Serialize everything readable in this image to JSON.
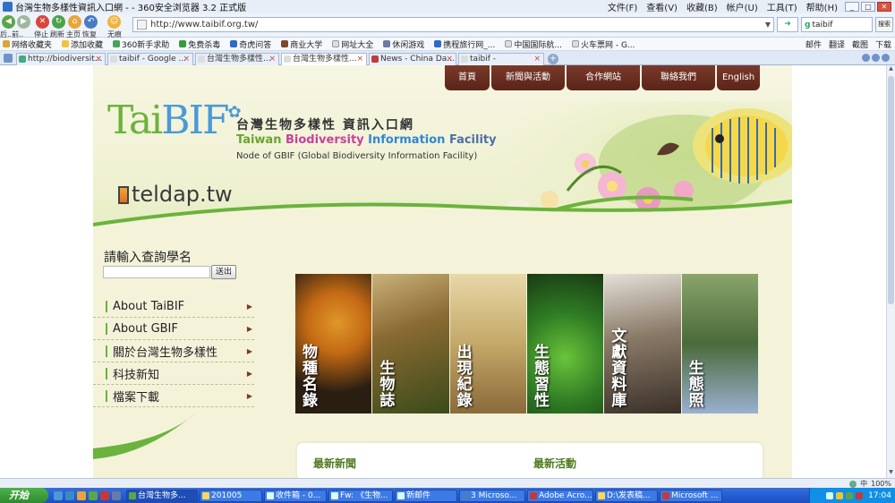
{
  "browser": {
    "window_title": "台灣生物多樣性資訊入口網 - - 360安全浏览器 3.2 正式版",
    "menus": [
      "文件(F)",
      "查看(V)",
      "收藏(B)",
      "帐户(U)",
      "工具(T)",
      "帮助(H)"
    ],
    "nav_labels": [
      "后..前..",
      "停止",
      "刷新",
      "主页",
      "恢复",
      "无痕"
    ],
    "address": "http://www.taibif.org.tw/",
    "search_value": "taibif",
    "search_button": "搜索",
    "bookmarks": [
      "网络收藏夹",
      "添加收藏",
      "360新手求助",
      "免费杀毒",
      "奇虎问答",
      "商业大学",
      "网址大全",
      "休闲游戏",
      "携程旅行网_...",
      "中国国际航...",
      "火车票网 - G..."
    ],
    "bookmark_tools": [
      "邮件",
      "翻译",
      "截图",
      "下载"
    ],
    "tabs": [
      "http://biodiversit...",
      "taibif - Google ...",
      "台灣生物多樣性...",
      "台灣生物多樣性...",
      "News - China Da...",
      "taibif -"
    ],
    "active_tab": 3
  },
  "site": {
    "top_nav": [
      "首頁",
      "新聞與活動",
      "合作網站",
      "聯絡我們",
      "English"
    ],
    "logo_prefix": "Tai",
    "logo_bif": "BIF",
    "title_zh": "台灣生物多樣性 資訊入口網",
    "title_en_1": "Taiwan ",
    "title_en_2": "Biodiversity ",
    "title_en_3": "Information ",
    "title_en_4": "Facility",
    "gbif_line": "Node of GBIF (Global Biodiversity Information Facility)",
    "teldap": "teldap.tw",
    "search_label": "請輸入查詢學名",
    "search_button": "送出",
    "side_menu": [
      "About TaiBIF",
      "About GBIF",
      "關於台灣生物多樣性",
      "科技新知",
      "檔案下載"
    ],
    "gallery": [
      {
        "caption": "物種名錄",
        "color": "#3a2a18"
      },
      {
        "caption": "生物誌",
        "color": "#6a5a2a"
      },
      {
        "caption": "出現紀錄",
        "color": "#b89a55"
      },
      {
        "caption": "生態習性",
        "color": "#2e7a24"
      },
      {
        "caption": "文獻資料庫",
        "color": "#5a5248"
      },
      {
        "caption": "生態照",
        "color": "#5d6f4a"
      }
    ],
    "news_title": "最新新聞",
    "events_title": "最新活動"
  },
  "status": {
    "tray_text": "中",
    "zoom": "100%"
  },
  "taskbar": {
    "start": "开始",
    "buttons": [
      "台灣生物多...",
      "201005",
      "收件箱 - 0...",
      "Fw: 《生物...",
      "新邮件",
      "3 Microso...",
      "Adobe Acro...",
      "D:\\发表稿...",
      "Microsoft ..."
    ],
    "active": 0,
    "clock": "17:04"
  }
}
